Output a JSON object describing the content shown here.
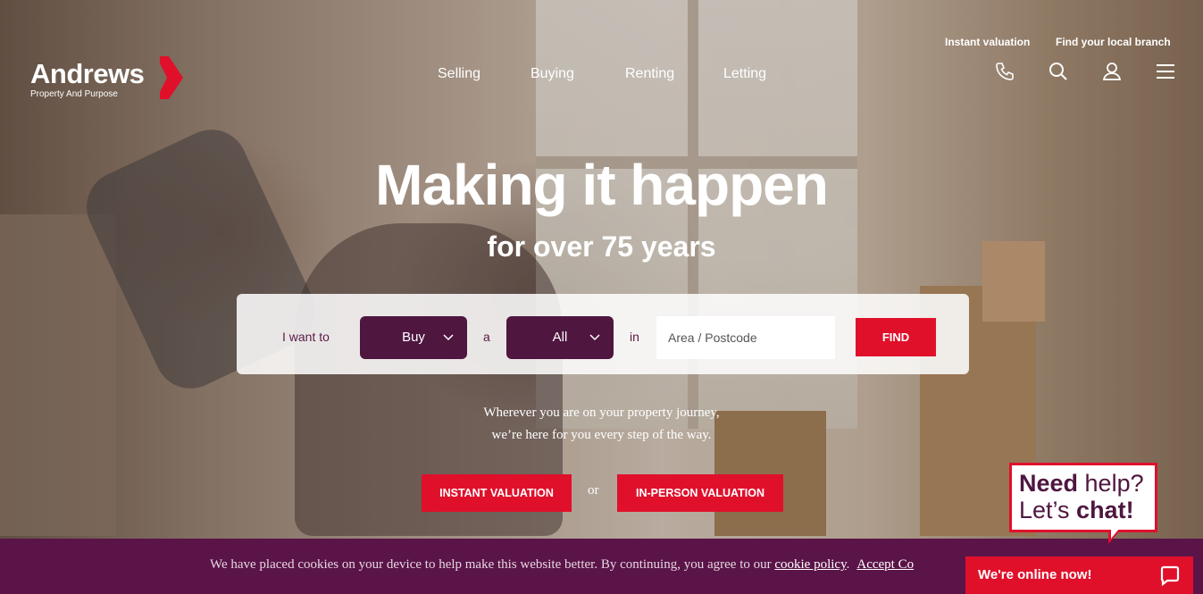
{
  "brand": {
    "name": "Andrews",
    "tagline": "Property And Purpose",
    "accent": "#e0102b",
    "primary": "#4f1640"
  },
  "nav": {
    "items": [
      "Selling",
      "Buying",
      "Renting",
      "Letting"
    ]
  },
  "top_links": {
    "instant_valuation": "Instant valuation",
    "find_branch": "Find your local branch"
  },
  "icons": [
    "phone-icon",
    "search-icon",
    "account-icon",
    "menu-icon"
  ],
  "hero": {
    "title": "Making it happen",
    "subtitle": "for over 75 years"
  },
  "search": {
    "label_i_want_to": "I want to",
    "intent_value": "Buy",
    "label_a": "a",
    "type_value": "All",
    "label_in": "in",
    "area_placeholder": "Area / Postcode",
    "find_label": "FIND"
  },
  "journey": {
    "line1": "Wherever you are on your property journey,",
    "line2": "we’re here for you every step of the way."
  },
  "cta": {
    "instant": "INSTANT VALUATION",
    "or": "or",
    "in_person": "IN-PERSON VALUATION"
  },
  "cookie": {
    "text": "We have placed cookies on your device to help make this website better. By continuing, you agree to our ",
    "policy_link": "cookie policy",
    "after": ".",
    "accept": "Accept Co"
  },
  "chat": {
    "need": "Need",
    "help": " help?",
    "lets": "Let’s ",
    "chat_word": "chat!",
    "online": "We're online now!"
  }
}
